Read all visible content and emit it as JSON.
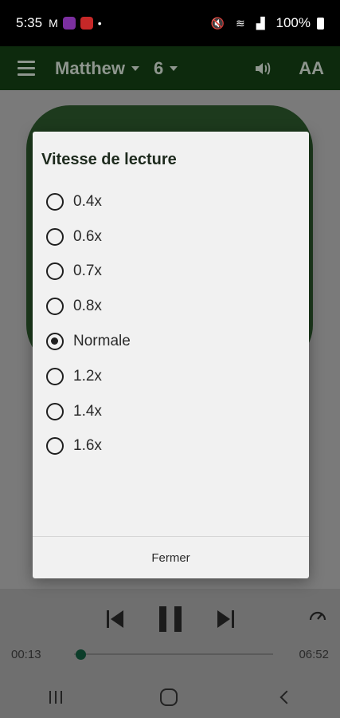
{
  "status_bar": {
    "time": "5:35",
    "battery": "100%"
  },
  "appbar": {
    "book": "Matthew",
    "chapter": "6",
    "font_icon_label": "AA"
  },
  "dialog": {
    "title": "Vitesse de lecture",
    "options": [
      {
        "label": "0.4x",
        "selected": false
      },
      {
        "label": "0.6x",
        "selected": false
      },
      {
        "label": "0.7x",
        "selected": false
      },
      {
        "label": "0.8x",
        "selected": false
      },
      {
        "label": "Normale",
        "selected": true
      },
      {
        "label": "1.2x",
        "selected": false
      },
      {
        "label": "1.4x",
        "selected": false
      },
      {
        "label": "1.6x",
        "selected": false
      }
    ],
    "close_label": "Fermer"
  },
  "player": {
    "current_time": "00:13",
    "total_time": "06:52",
    "progress": 0.032
  },
  "colors": {
    "appbar_bg": "#0d2a0d",
    "accent": "#0c3d2a",
    "dialog_bg": "#f1f1f1"
  }
}
